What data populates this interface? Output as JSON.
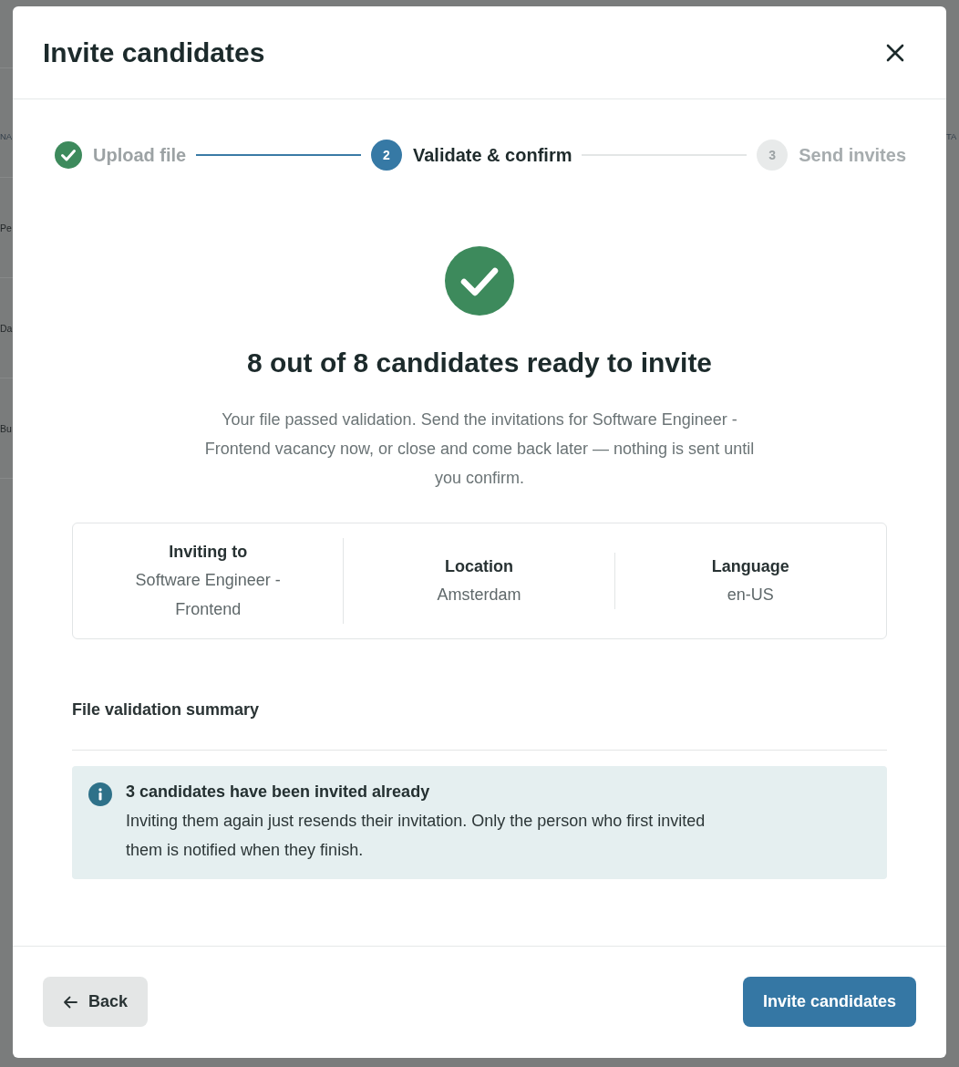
{
  "background_page": {
    "left_fragments": [
      {
        "text": "NA",
        "kind": "header"
      },
      {
        "text": "Pe",
        "kind": "row"
      },
      {
        "text": "Da",
        "kind": "row"
      },
      {
        "text": "Bu",
        "kind": "row"
      }
    ],
    "right_fragments": [
      {
        "text": "TA",
        "kind": "header"
      }
    ]
  },
  "modal": {
    "title": "Invite candidates"
  },
  "stepper": {
    "steps": [
      {
        "label": "Upload file",
        "completed": true,
        "current": false
      },
      {
        "number": "2",
        "label": "Validate & confirm",
        "completed": false,
        "current": true
      },
      {
        "number": "3",
        "label": "Send invites",
        "completed": false,
        "current": false
      }
    ]
  },
  "result": {
    "heading": "8 out of 8 candidates ready to invite",
    "message": "Your file passed validation. Send the invitations for Software Engineer - Frontend vacancy now, or close and come back later — nothing is sent until you confirm."
  },
  "details": [
    {
      "label": "Inviting to",
      "value": "Software Engineer - Frontend"
    },
    {
      "label": "Location",
      "value": "Amsterdam"
    },
    {
      "label": "Language",
      "value": "en-US"
    }
  ],
  "validation_summary": {
    "title": "File validation summary",
    "alert": {
      "kind": "info",
      "title": "3 candidates have been invited already",
      "message": "Inviting them again just resends their invitation. Only the person who first invited them is notified when they finish."
    }
  },
  "footer": {
    "buttons": [
      {
        "label": "Back",
        "kind": "back"
      },
      {
        "label": "Invite candidates",
        "kind": "primary"
      }
    ]
  }
}
